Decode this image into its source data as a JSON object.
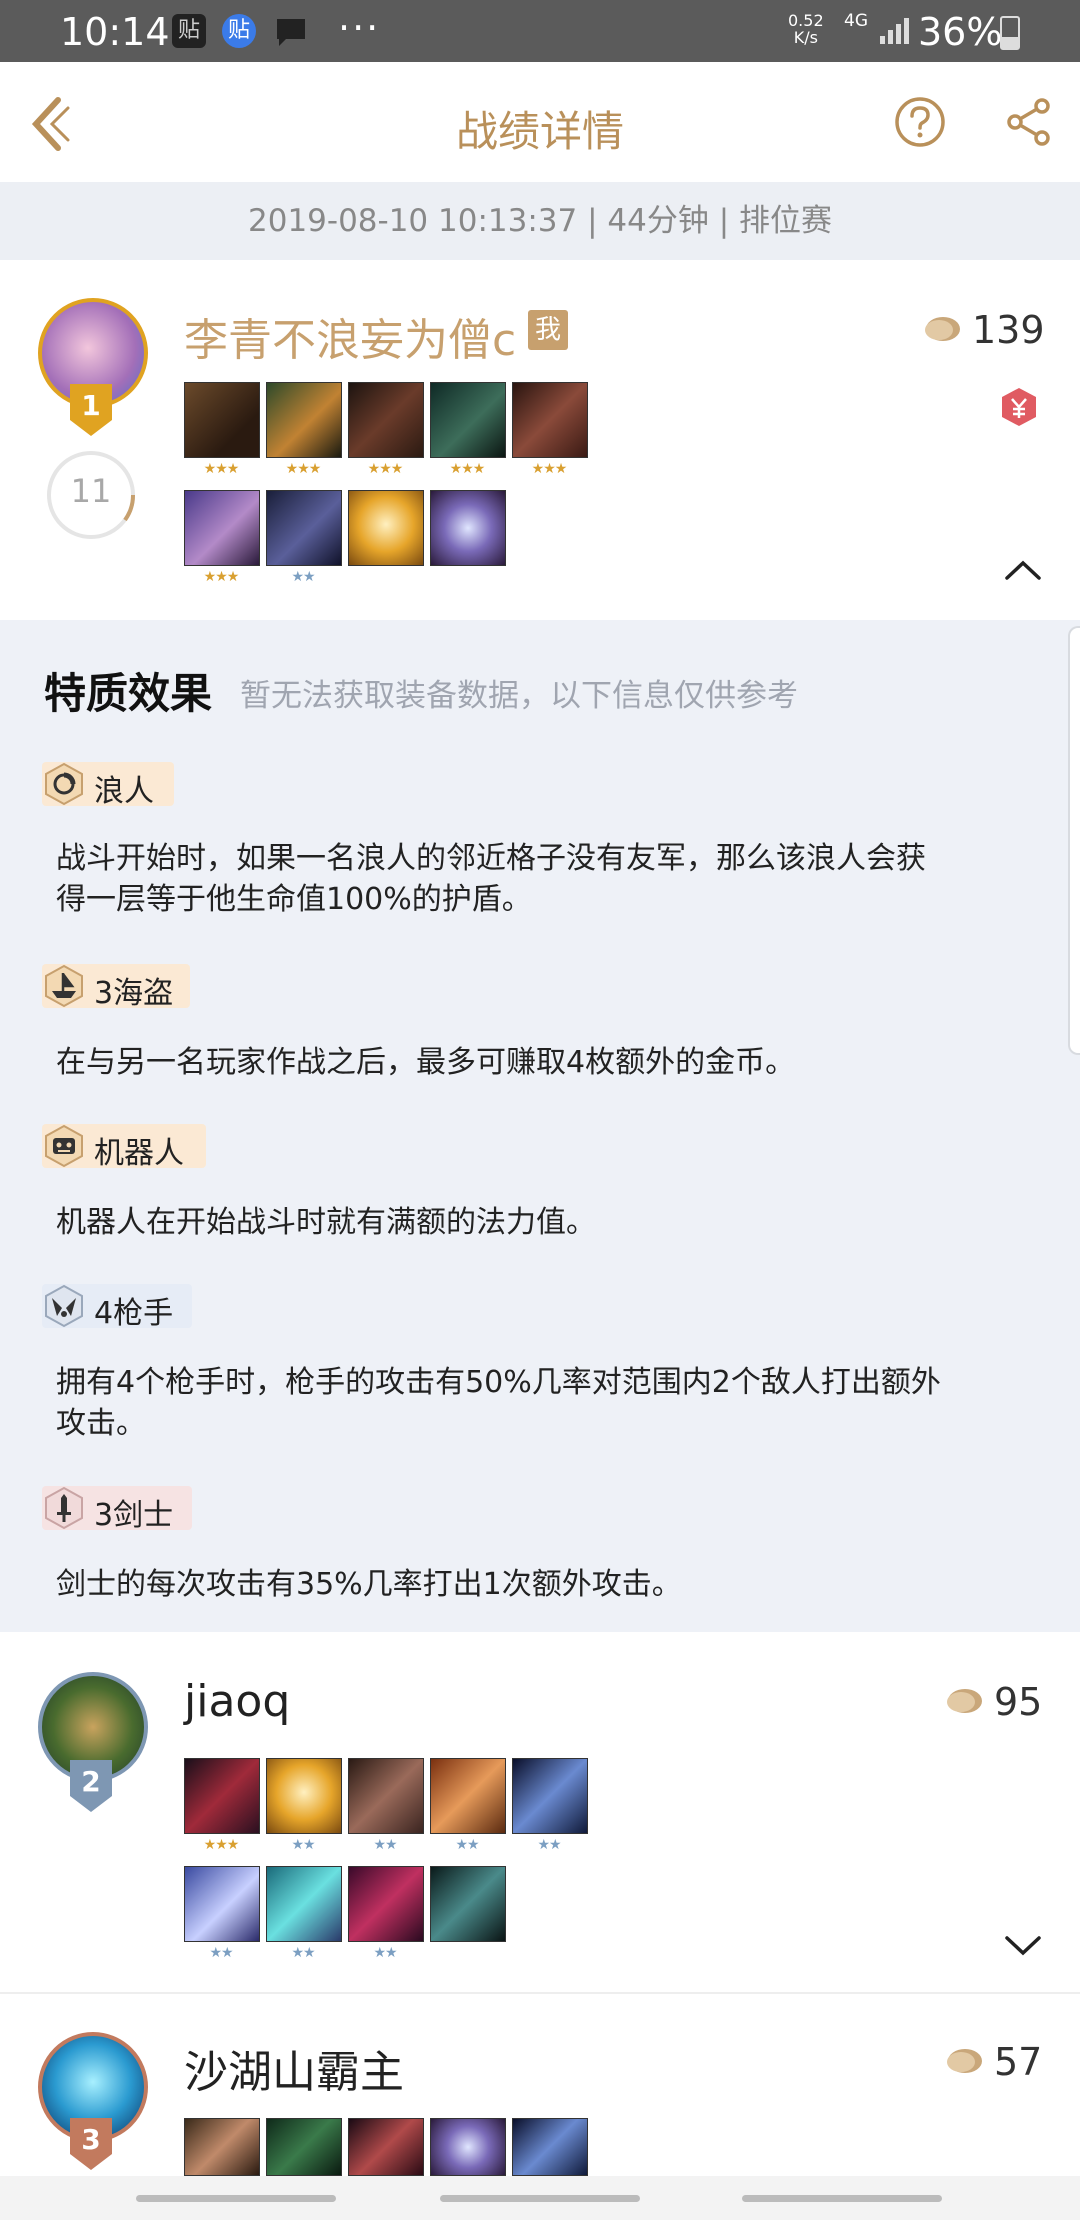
{
  "status_bar": {
    "time": "10:14",
    "app_icon_1": "贴",
    "app_icon_2": "贴",
    "dots": "···",
    "speed_value": "0.52",
    "speed_unit": "K/s",
    "network": "4G",
    "battery": "36%"
  },
  "header": {
    "title": "战绩详情"
  },
  "match_info": "2019-08-10 10:13:37 | 44分钟 | 排位赛",
  "players": [
    {
      "rank": "1",
      "name": "李青不浪妄为僧c",
      "me_tag": "我",
      "score": "139",
      "level": "11",
      "heroes_row1_stars": [
        "★★★",
        "★★★",
        "★★★",
        "★★★",
        "★★★"
      ],
      "heroes_row2_stars": [
        "★★★",
        "★★",
        "",
        ""
      ]
    },
    {
      "rank": "2",
      "name": "jiaoq",
      "score": "95",
      "heroes_row1_stars": [
        "★★★",
        "★★",
        "★★",
        "★★",
        "★★"
      ],
      "heroes_row2_stars": [
        "★★",
        "★★",
        "★★",
        ""
      ]
    },
    {
      "rank": "3",
      "name": "沙湖山霸主",
      "score": "57"
    }
  ],
  "traits": {
    "title": "特质效果",
    "note": "暂无法获取装备数据，以下信息仅供参考",
    "items": [
      {
        "name": "浪人",
        "desc_line1": "战斗开始时，如果一名浪人的邻近格子没有友军，那么该浪人会获",
        "desc_line2": "得一层等于他生命值100%的护盾。"
      },
      {
        "name": "3海盗",
        "desc_line1": "在与另一名玩家作战之后，最多可赚取4枚额外的金币。",
        "desc_line2": ""
      },
      {
        "name": "机器人",
        "desc_line1": "机器人在开始战斗时就有满额的法力值。",
        "desc_line2": ""
      },
      {
        "name": "4枪手",
        "desc_line1": "拥有4个枪手时，枪手的攻击有50%几率对范围内2个敌人打出额外",
        "desc_line2": "攻击。"
      },
      {
        "name": "3剑士",
        "desc_line1": "剑士的每次攻击有35%几率打出1次额外攻击。",
        "desc_line2": ""
      }
    ]
  },
  "colors": {
    "accent": "#b9905a",
    "gold_rank": "#e0a321",
    "silver_rank": "#7e97b3",
    "bronze_rank": "#c27a5e",
    "trait_tag_bg": "#fbe9d4"
  }
}
